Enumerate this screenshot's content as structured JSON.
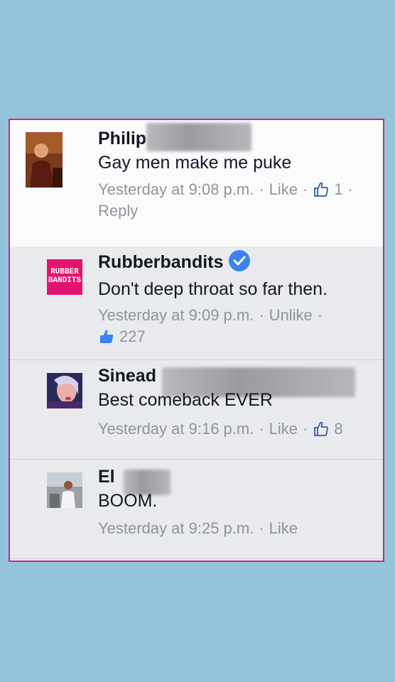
{
  "comments": [
    {
      "name": "Philip",
      "text": "Gay men make me puke",
      "time": "Yesterday at 9:08 p.m.",
      "action": "Like",
      "likes": "1",
      "reply": "Reply"
    },
    {
      "name": "Rubberbandits",
      "verified": true,
      "avatar_text": "RUBBER BANDITS",
      "text": "Don't deep throat so far then.",
      "time": "Yesterday at 9:09 p.m.",
      "action": "Unlike",
      "likes": "227"
    },
    {
      "name": "Sinead",
      "text": "Best comeback EVER",
      "time": "Yesterday at 9:16 p.m.",
      "action": "Like",
      "likes": "8"
    },
    {
      "name": "El",
      "text": "BOOM.",
      "time": "Yesterday at 9:25 p.m.",
      "action": "Like"
    }
  ],
  "colors": {
    "background": "#94c4dc",
    "frame_border": "#c02a8a",
    "link_blue": "#3b5998",
    "verified_blue": "#3b82f0",
    "meta_grey": "#8f949d"
  },
  "icons": [
    "thumbs-up-outline-icon",
    "thumbs-up-filled-icon",
    "verified-check-icon"
  ]
}
